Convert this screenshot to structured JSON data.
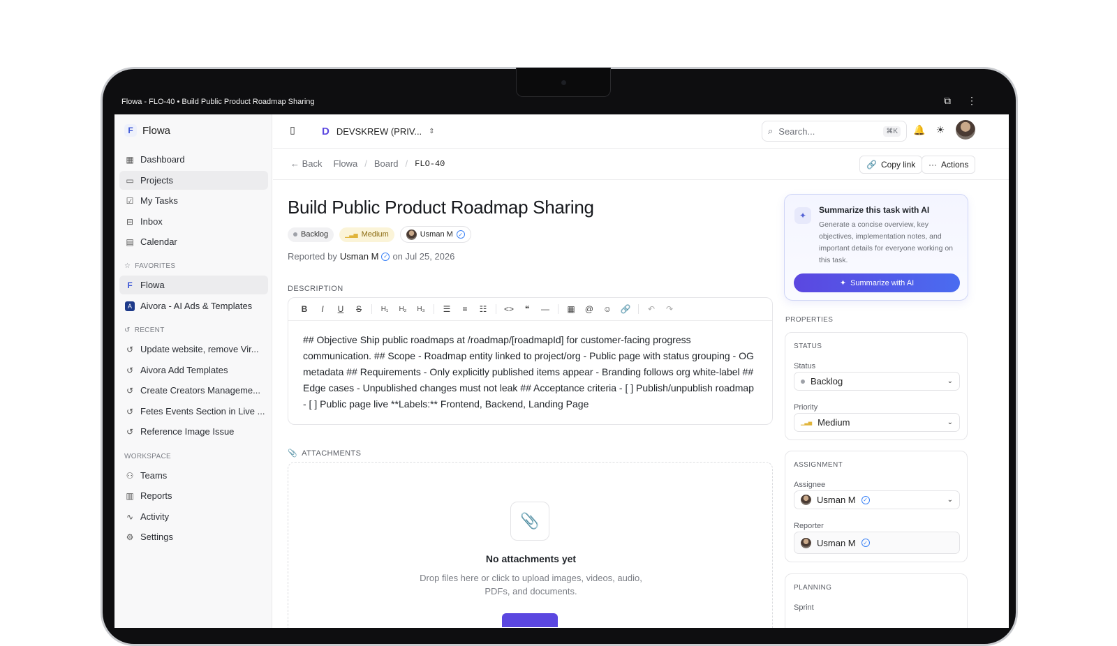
{
  "window": {
    "title": "Flowa - FLO-40 • Build Public Product Roadmap Sharing"
  },
  "sidebar": {
    "brand": "Flowa",
    "nav": [
      {
        "label": "Dashboard",
        "icon": "dashboard-icon"
      },
      {
        "label": "Projects",
        "icon": "folder-icon",
        "active": true
      },
      {
        "label": "My Tasks",
        "icon": "checkbox-icon"
      },
      {
        "label": "Inbox",
        "icon": "inbox-icon"
      },
      {
        "label": "Calendar",
        "icon": "calendar-icon"
      }
    ],
    "favorites_label": "FAVORITES",
    "favorites": [
      {
        "label": "Flowa",
        "active": true
      },
      {
        "label": "Aivora - AI Ads & Templates"
      }
    ],
    "recent_label": "RECENT",
    "recent": [
      {
        "label": "Update website, remove Vir..."
      },
      {
        "label": "Aivora Add Templates"
      },
      {
        "label": "Create Creators Manageme..."
      },
      {
        "label": "Fetes Events Section in Live ..."
      },
      {
        "label": "Reference Image Issue"
      }
    ],
    "workspace_label": "WORKSPACE",
    "workspace": [
      {
        "label": "Teams"
      },
      {
        "label": "Reports"
      },
      {
        "label": "Activity"
      },
      {
        "label": "Settings"
      }
    ]
  },
  "topbar": {
    "workspace": "DEVSKREW (PRIV...",
    "search_placeholder": "Search...",
    "search_shortcut": "⌘K"
  },
  "breadcrumb": {
    "back": "Back",
    "items": [
      "Flowa",
      "Board"
    ],
    "current": "FLO-40",
    "copy_link": "Copy link",
    "actions": "Actions"
  },
  "task": {
    "title": "Build Public Product Roadmap Sharing",
    "status": "Backlog",
    "priority": "Medium",
    "assignee": "Usman M",
    "reported_prefix": "Reported by",
    "reporter": "Usman M",
    "reported_date": "on Jul 25, 2026",
    "description_label": "DESCRIPTION",
    "description": "## Objective Ship public roadmaps at /roadmap/[roadmapId] for customer-facing progress communication. ## Scope - Roadmap entity linked to project/org - Public page with status grouping - OG metadata ## Requirements - Only explicitly published items appear - Branding follows org white-label ## Edge cases - Unpublished changes must not leak ## Acceptance criteria - [ ] Publish/unpublish roadmap - [ ] Public page live **Labels:** Frontend, Backend, Landing Page",
    "toolbar": [
      "bold",
      "italic",
      "underline",
      "strikethrough",
      "h1",
      "h2",
      "h3",
      "bullet-list",
      "ordered-list",
      "task-list",
      "code",
      "quote",
      "divider",
      "table",
      "mention",
      "emoji",
      "link",
      "undo",
      "redo"
    ]
  },
  "attachments": {
    "label": "ATTACHMENTS",
    "empty_title": "No attachments yet",
    "empty_sub": "Drop files here or click to upload images, videos, audio, PDFs, and documents."
  },
  "ai": {
    "title": "Summarize this task with AI",
    "text": "Generate a concise overview, key objectives, implementation notes, and important details for everyone working on this task.",
    "button": "Summarize with AI"
  },
  "properties": {
    "label": "PROPERTIES",
    "status_section": "STATUS",
    "status_label": "Status",
    "status_value": "Backlog",
    "priority_label": "Priority",
    "priority_value": "Medium",
    "assignment_section": "ASSIGNMENT",
    "assignee_label": "Assignee",
    "assignee_value": "Usman M",
    "reporter_label": "Reporter",
    "reporter_value": "Usman M",
    "planning_section": "PLANNING",
    "sprint_label": "Sprint"
  },
  "colors": {
    "accent": "#5b47e0",
    "medium": "#e0b43a",
    "verified": "#3b82f6"
  }
}
